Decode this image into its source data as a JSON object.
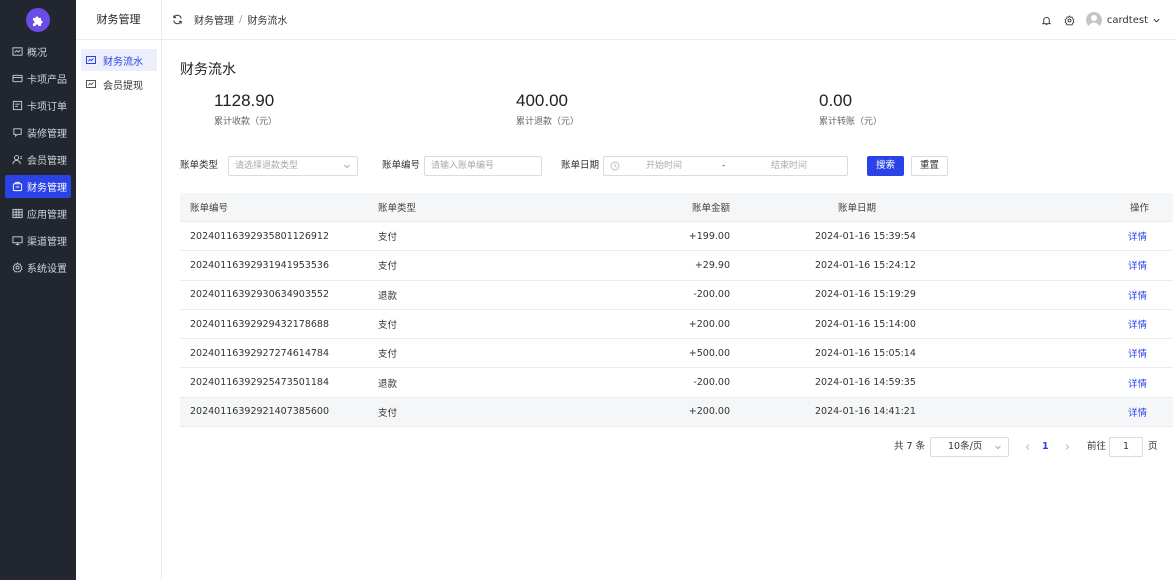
{
  "sidebar": {
    "items": [
      {
        "label": "概况",
        "icon": "dashboard-icon",
        "active": false
      },
      {
        "label": "卡项产品",
        "icon": "card-icon",
        "active": false
      },
      {
        "label": "卡项订单",
        "icon": "order-icon",
        "active": false
      },
      {
        "label": "装修管理",
        "icon": "decoration-icon",
        "active": false
      },
      {
        "label": "会员管理",
        "icon": "member-icon",
        "active": false
      },
      {
        "label": "财务管理",
        "icon": "finance-icon",
        "active": true
      },
      {
        "label": "应用管理",
        "icon": "apps-icon",
        "active": false
      },
      {
        "label": "渠道管理",
        "icon": "channel-icon",
        "active": false
      },
      {
        "label": "系统设置",
        "icon": "settings-icon",
        "active": false
      }
    ]
  },
  "submenu": {
    "title": "财务管理",
    "items": [
      {
        "label": "财务流水",
        "active": true
      },
      {
        "label": "会员提现",
        "active": false
      }
    ]
  },
  "header": {
    "breadcrumb": [
      "财务管理",
      "财务流水"
    ],
    "separator": "/",
    "username": "cardtest"
  },
  "page": {
    "title": "财务流水",
    "stats": [
      {
        "value": "1128.90",
        "label": "累计收款（元）"
      },
      {
        "value": "400.00",
        "label": "累计退款（元）"
      },
      {
        "value": "0.00",
        "label": "累计转账（元）"
      }
    ]
  },
  "filters": {
    "bill_type_label": "账单类型",
    "bill_type_placeholder": "请选择退款类型",
    "bill_no_label": "账单编号",
    "bill_no_placeholder": "请输入账单编号",
    "bill_date_label": "账单日期",
    "date_start_placeholder": "开始时间",
    "date_sep": "-",
    "date_end_placeholder": "结束时间",
    "search_label": "搜索",
    "reset_label": "重置"
  },
  "table": {
    "columns": [
      "账单编号",
      "账单类型",
      "账单金额",
      "账单日期",
      "操作"
    ],
    "action_label": "详情",
    "rows": [
      {
        "id": "20240116392935801126912",
        "type": "支付",
        "amount": "+199.00",
        "date": "2024-01-16 15:39:54"
      },
      {
        "id": "20240116392931941953536",
        "type": "支付",
        "amount": "+29.90",
        "date": "2024-01-16 15:24:12"
      },
      {
        "id": "20240116392930634903552",
        "type": "退款",
        "amount": "-200.00",
        "date": "2024-01-16 15:19:29"
      },
      {
        "id": "20240116392929432178688",
        "type": "支付",
        "amount": "+200.00",
        "date": "2024-01-16 15:14:00"
      },
      {
        "id": "20240116392927274614784",
        "type": "支付",
        "amount": "+500.00",
        "date": "2024-01-16 15:05:14"
      },
      {
        "id": "20240116392925473501184",
        "type": "退款",
        "amount": "-200.00",
        "date": "2024-01-16 14:59:35"
      },
      {
        "id": "20240116392921407385600",
        "type": "支付",
        "amount": "+200.00",
        "date": "2024-01-16 14:41:21"
      }
    ]
  },
  "pagination": {
    "total": "共 7 条",
    "page_size": "10条/页",
    "current_page": "1",
    "goto_label": "前往",
    "goto_value": "1",
    "goto_unit": "页"
  },
  "colors": {
    "sidebar_bg": "#22262e",
    "accent": "#2b43e6",
    "logo": "#6a4de8"
  }
}
